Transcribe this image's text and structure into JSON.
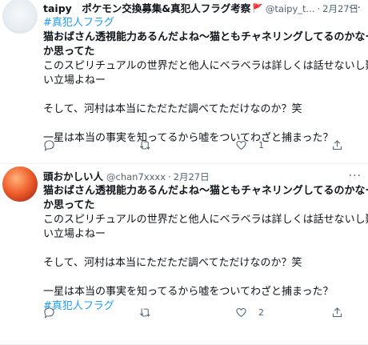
{
  "tweets": [
    {
      "display_name": "taipy　ポケモン交換募集&真犯人フラグ考察",
      "flag_glyph": "🚩",
      "handle": "@taipy_t...",
      "dot": "·",
      "date": "2月27日",
      "more": "···",
      "lines": [
        {
          "text": "#真犯人フラグ",
          "style": "hashtag"
        },
        {
          "text": "猫おばさん透視能力あるんだよね〜猫ともチャネリングしてるのかなーと",
          "style": "bold"
        },
        {
          "text": "か思ってた",
          "style": "bold"
        },
        {
          "text": "このスピリチュアルの世界だと他人にベラベラは詳しくは話せないし難し",
          "style": "normal"
        },
        {
          "text": "い立場よねー",
          "style": "normal"
        },
        {
          "text": " ",
          "style": "normal"
        },
        {
          "text": "そして、河村は本当にただただ調べてただけなのか？笑",
          "style": "normal"
        },
        {
          "text": " ",
          "style": "normal"
        },
        {
          "text": "一星は本当の事実を知ってるから嘘をついてわざと捕まった？",
          "style": "normal"
        }
      ],
      "actions": {
        "reply_count": "",
        "retweet_count": "",
        "like_count": "1"
      }
    },
    {
      "display_name": "頭おかしい人",
      "handle": "@chan7xxxx",
      "dot": "·",
      "date": "2月27日",
      "more": "···",
      "lines": [
        {
          "text": "猫おばさん透視能力あるんだよね〜猫ともチャネリングしてるのかなーと",
          "style": "bold"
        },
        {
          "text": "か思ってた",
          "style": "bold"
        },
        {
          "text": "このスピリチュアルの世界だと他人にベラベラは詳しくは話せないし難し",
          "style": "normal"
        },
        {
          "text": "い立場よねー",
          "style": "normal"
        },
        {
          "text": " ",
          "style": "normal"
        },
        {
          "text": "そして、河村は本当にただただ調べてただけなのか？笑",
          "style": "normal"
        },
        {
          "text": " ",
          "style": "normal"
        },
        {
          "text": "一星は本当の事実を知ってるから嘘をついてわざと捕まった？",
          "style": "normal"
        },
        {
          "text": "#真犯人フラグ",
          "style": "hashtag"
        }
      ],
      "actions": {
        "reply_count": "",
        "retweet_count": "",
        "like_count": "2"
      }
    }
  ],
  "colors": {
    "accent": "#1d9bf0",
    "muted": "#536471",
    "text": "#0f1419",
    "flag": "#e0245e"
  },
  "icons": [
    "reply-icon",
    "retweet-icon",
    "like-icon",
    "share-icon",
    "more-icon",
    "flag-icon"
  ]
}
